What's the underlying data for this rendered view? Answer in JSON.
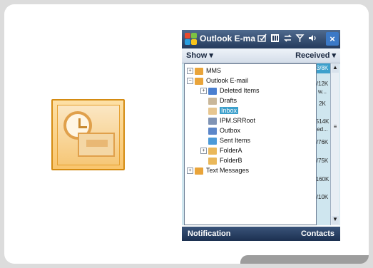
{
  "window": {
    "title": "Outlook E-ma",
    "close_label": "×",
    "status_icons": [
      "new-message-icon",
      "signal-battery-icon",
      "sync-icon",
      "antenna-icon",
      "volume-icon"
    ]
  },
  "menu": {
    "left": "Show ▾",
    "right": "Received ▾"
  },
  "tree": [
    {
      "label": "MMS",
      "expander": "+",
      "icon": "mail-folder-icon"
    },
    {
      "label": "Outlook E-mail",
      "expander": "−",
      "icon": "mail-folder-icon"
    },
    {
      "label": "Deleted Items",
      "expander": "+",
      "icon": "deleted-items-icon"
    },
    {
      "label": "Drafts",
      "expander": "",
      "icon": "drafts-icon"
    },
    {
      "label": "Inbox",
      "expander": "",
      "icon": "inbox-icon",
      "selected": true
    },
    {
      "label": "IPM.SRRoot",
      "expander": "",
      "icon": "folder-icon"
    },
    {
      "label": "Outbox",
      "expander": "",
      "icon": "outbox-icon"
    },
    {
      "label": "Sent Items",
      "expander": "",
      "icon": "sent-items-icon"
    },
    {
      "label": "FolderA",
      "expander": "+",
      "icon": "folder-icon"
    },
    {
      "label": "FolderB",
      "expander": "",
      "icon": "folder-icon"
    },
    {
      "label": "Text Messages",
      "expander": "+",
      "icon": "mail-folder-icon"
    }
  ],
  "sizes": [
    "3/8K",
    "/12K",
    "w...",
    "2K",
    "514K",
    "ed...",
    "/76K",
    "/75K",
    "160K",
    "/10K"
  ],
  "softkeys": {
    "left": "Notification",
    "right": "Contacts"
  },
  "colors": {
    "titlebar": "#243a5c",
    "selection": "#3da0cc",
    "close_button": "#3b79c7"
  }
}
